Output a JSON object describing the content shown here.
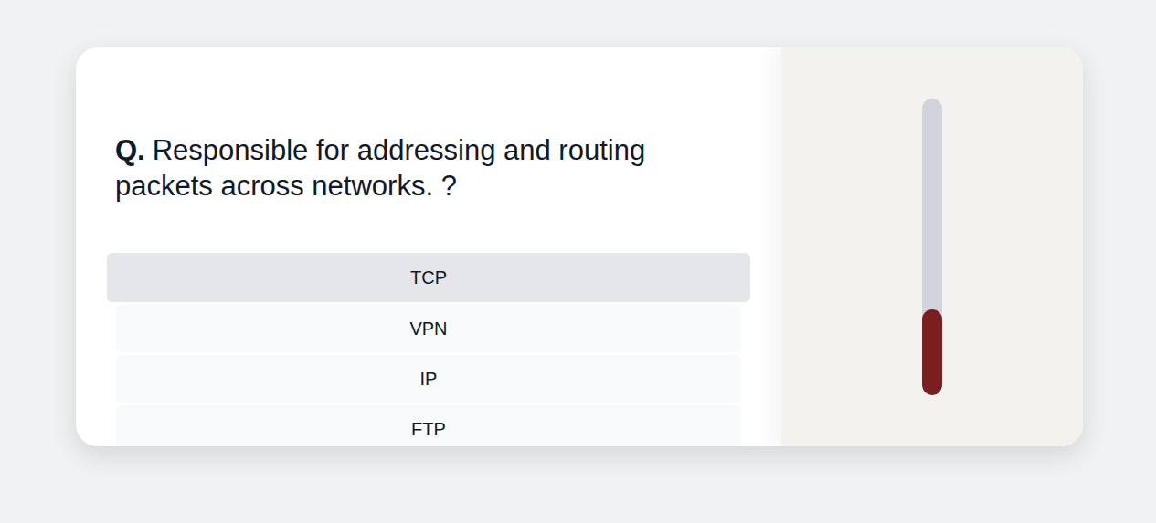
{
  "question": {
    "label": "Q.",
    "text": "Responsible for addressing and routing packets across networks. ?"
  },
  "options": [
    {
      "label": "TCP",
      "selected": true
    },
    {
      "label": "VPN",
      "selected": false
    },
    {
      "label": "IP",
      "selected": false
    },
    {
      "label": "FTP",
      "selected": false
    }
  ],
  "timer": {
    "level": 0.29
  }
}
